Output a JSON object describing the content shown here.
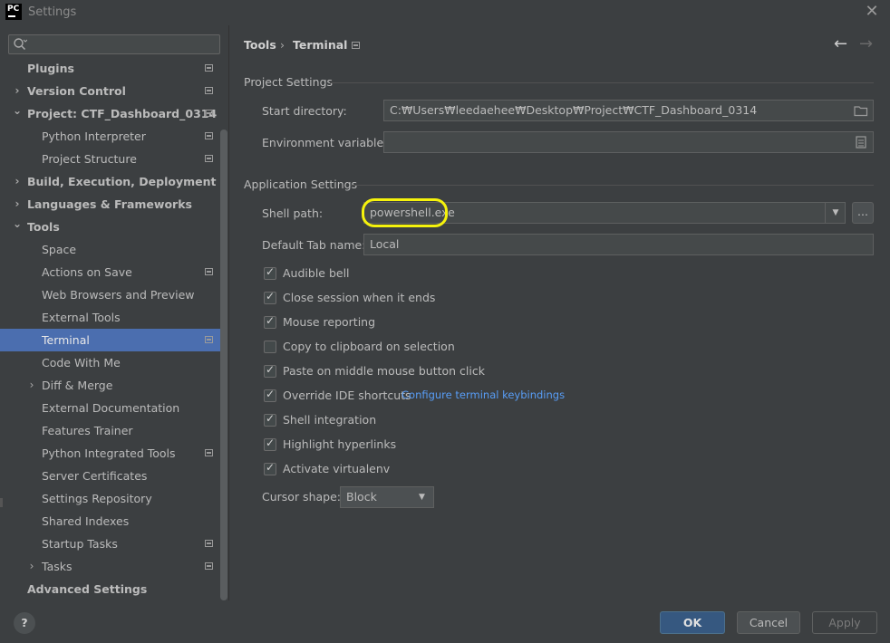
{
  "window": {
    "title": "Settings",
    "logo_text": "PC"
  },
  "search": {
    "placeholder": ""
  },
  "sidebar": {
    "items": [
      {
        "label": "Plugins",
        "bold": true,
        "indent": 0,
        "chevron": "",
        "proj_icon": true
      },
      {
        "label": "Version Control",
        "bold": true,
        "indent": 0,
        "chevron": "right",
        "proj_icon": true
      },
      {
        "label": "Project: CTF_Dashboard_0314",
        "bold": true,
        "indent": 0,
        "chevron": "down",
        "proj_icon": true
      },
      {
        "label": "Python Interpreter",
        "bold": false,
        "indent": 1,
        "chevron": "",
        "proj_icon": true
      },
      {
        "label": "Project Structure",
        "bold": false,
        "indent": 1,
        "chevron": "",
        "proj_icon": true
      },
      {
        "label": "Build, Execution, Deployment",
        "bold": true,
        "indent": 0,
        "chevron": "right",
        "proj_icon": false
      },
      {
        "label": "Languages & Frameworks",
        "bold": true,
        "indent": 0,
        "chevron": "right",
        "proj_icon": false
      },
      {
        "label": "Tools",
        "bold": true,
        "indent": 0,
        "chevron": "down",
        "proj_icon": false
      },
      {
        "label": "Space",
        "bold": false,
        "indent": 1,
        "chevron": "",
        "proj_icon": false
      },
      {
        "label": "Actions on Save",
        "bold": false,
        "indent": 1,
        "chevron": "",
        "proj_icon": true
      },
      {
        "label": "Web Browsers and Preview",
        "bold": false,
        "indent": 1,
        "chevron": "",
        "proj_icon": false
      },
      {
        "label": "External Tools",
        "bold": false,
        "indent": 1,
        "chevron": "",
        "proj_icon": false
      },
      {
        "label": "Terminal",
        "bold": false,
        "indent": 1,
        "chevron": "",
        "proj_icon": true,
        "selected": true
      },
      {
        "label": "Code With Me",
        "bold": false,
        "indent": 1,
        "chevron": "",
        "proj_icon": false
      },
      {
        "label": "Diff & Merge",
        "bold": false,
        "indent": 1,
        "chevron": "right",
        "proj_icon": false
      },
      {
        "label": "External Documentation",
        "bold": false,
        "indent": 1,
        "chevron": "",
        "proj_icon": false
      },
      {
        "label": "Features Trainer",
        "bold": false,
        "indent": 1,
        "chevron": "",
        "proj_icon": false
      },
      {
        "label": "Python Integrated Tools",
        "bold": false,
        "indent": 1,
        "chevron": "",
        "proj_icon": true
      },
      {
        "label": "Server Certificates",
        "bold": false,
        "indent": 1,
        "chevron": "",
        "proj_icon": false
      },
      {
        "label": "Settings Repository",
        "bold": false,
        "indent": 1,
        "chevron": "",
        "proj_icon": false
      },
      {
        "label": "Shared Indexes",
        "bold": false,
        "indent": 1,
        "chevron": "",
        "proj_icon": false
      },
      {
        "label": "Startup Tasks",
        "bold": false,
        "indent": 1,
        "chevron": "",
        "proj_icon": true
      },
      {
        "label": "Tasks",
        "bold": false,
        "indent": 1,
        "chevron": "right",
        "proj_icon": true
      },
      {
        "label": "Advanced Settings",
        "bold": true,
        "indent": 0,
        "chevron": "",
        "proj_icon": false
      }
    ]
  },
  "breadcrumb": {
    "parent": "Tools",
    "separator": "›",
    "current": "Terminal"
  },
  "nav": {
    "back": "←",
    "forward": "→"
  },
  "project_settings": {
    "title": "Project Settings",
    "start_directory_label": "Start directory:",
    "start_directory_value": "C:₩Users₩leedaehee₩Desktop₩Project₩CTF_Dashboard_0314",
    "env_vars_label": "Environment variables:",
    "env_vars_value": ""
  },
  "application_settings": {
    "title": "Application Settings",
    "shell_path_label": "Shell path:",
    "shell_path_value": "powershell.exe",
    "browse_button": "...",
    "default_tab_label": "Default Tab name:",
    "default_tab_value": "Local",
    "checkboxes": [
      {
        "label": "Audible bell",
        "checked": true
      },
      {
        "label": "Close session when it ends",
        "checked": true
      },
      {
        "label": "Mouse reporting",
        "checked": true
      },
      {
        "label": "Copy to clipboard on selection",
        "checked": false
      },
      {
        "label": "Paste on middle mouse button click",
        "checked": true
      },
      {
        "label": "Override IDE shortcuts",
        "checked": true
      },
      {
        "label": "Shell integration",
        "checked": true
      },
      {
        "label": "Highlight hyperlinks",
        "checked": true
      },
      {
        "label": "Activate virtualenv",
        "checked": true
      }
    ],
    "keybindings_link": "Configure terminal keybindings",
    "cursor_shape_label": "Cursor shape:",
    "cursor_shape_value": "Block"
  },
  "footer": {
    "help": "?",
    "ok": "OK",
    "cancel": "Cancel",
    "apply": "Apply"
  },
  "colors": {
    "highlight": "#f5f20c",
    "selection": "#4b6eaf",
    "link": "#589df6"
  }
}
